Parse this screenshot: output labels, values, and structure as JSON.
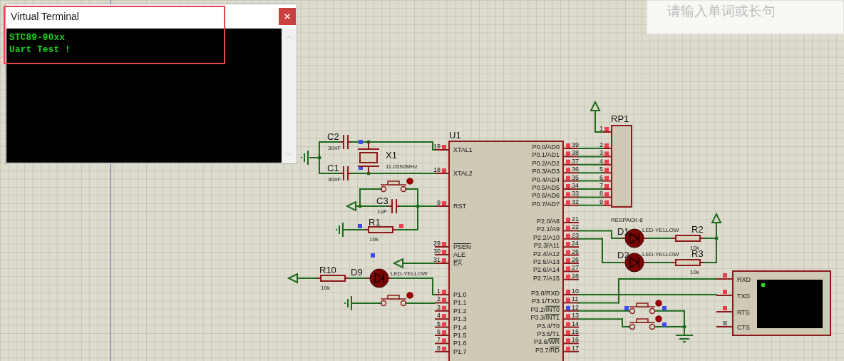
{
  "terminal_window": {
    "title": "Virtual Terminal",
    "lines": [
      "STC89-90xx",
      "Uart Test !"
    ]
  },
  "lookup_box": {
    "placeholder": "请输入单词或长句"
  },
  "schematic": {
    "u1": {
      "ref": "U1",
      "left_pins": [
        {
          "num": "19",
          "name": "XTAL1"
        },
        {
          "num": "18",
          "name": "XTAL2"
        },
        {
          "num": "9",
          "name": "RST"
        },
        {
          "num": "29",
          "inverted": "PSEN"
        },
        {
          "num": "30",
          "name": "ALE"
        },
        {
          "num": "31",
          "inverted": "EA"
        },
        {
          "num": "1",
          "name": "P1.0"
        },
        {
          "num": "2",
          "name": "P1.1"
        },
        {
          "num": "3",
          "name": "P1.2"
        },
        {
          "num": "4",
          "name": "P1.3"
        },
        {
          "num": "5",
          "name": "P1.4"
        },
        {
          "num": "6",
          "name": "P1.5"
        },
        {
          "num": "7",
          "name": "P1.6"
        },
        {
          "num": "8",
          "name": "P1.7"
        }
      ],
      "right_pins": [
        {
          "num": "39",
          "name": "P0.0/AD0"
        },
        {
          "num": "38",
          "name": "P0.1/AD1"
        },
        {
          "num": "37",
          "name": "P0.2/AD2"
        },
        {
          "num": "36",
          "name": "P0.3/AD3"
        },
        {
          "num": "35",
          "name": "P0.4/AD4"
        },
        {
          "num": "34",
          "name": "P0.5/AD5"
        },
        {
          "num": "33",
          "name": "P0.6/AD6"
        },
        {
          "num": "32",
          "name": "P0.7/AD7"
        },
        {
          "num": "21",
          "name": "P2.0/A8"
        },
        {
          "num": "22",
          "name": "P2.1/A9"
        },
        {
          "num": "23",
          "name": "P2.2/A10"
        },
        {
          "num": "24",
          "name": "P2.3/A11"
        },
        {
          "num": "25",
          "name": "P2.4/A12"
        },
        {
          "num": "26",
          "name": "P2.5/A13"
        },
        {
          "num": "27",
          "name": "P2.6/A14"
        },
        {
          "num": "28",
          "name": "P2.7/A15"
        },
        {
          "num": "10",
          "name": "P3.0/RXD"
        },
        {
          "num": "11",
          "name": "P3.1/TXD"
        },
        {
          "num": "12",
          "name": "P3.2/",
          "inverted": "INT0"
        },
        {
          "num": "13",
          "name": "P3.3/",
          "inverted": "INT1"
        },
        {
          "num": "14",
          "name": "P3.4/T0"
        },
        {
          "num": "15",
          "name": "P3.5/T1"
        },
        {
          "num": "16",
          "name": "P3.6/",
          "inverted": "WR"
        },
        {
          "num": "17",
          "name": "P3.7/",
          "inverted": "RD"
        }
      ]
    },
    "rp1": {
      "ref": "RP1",
      "value": "RESPACK-8",
      "pins": [
        "1",
        "2",
        "3",
        "4",
        "5",
        "6",
        "7",
        "8",
        "9"
      ]
    },
    "parts": [
      {
        "kind": "capacitor",
        "ref": "C2",
        "value": "30nF"
      },
      {
        "kind": "capacitor",
        "ref": "C1",
        "value": "30nF"
      },
      {
        "kind": "crystal",
        "ref": "X1",
        "value": "11.0592MHz"
      },
      {
        "kind": "capacitor",
        "ref": "C3",
        "value": "1uF"
      },
      {
        "kind": "resistor",
        "ref": "R1",
        "value": "10k"
      },
      {
        "kind": "resistor",
        "ref": "R10",
        "value": "10k"
      },
      {
        "kind": "led",
        "ref": "D9",
        "value": "LED-YELLOW"
      },
      {
        "kind": "led",
        "ref": "D1",
        "value": "LED-YELLOW"
      },
      {
        "kind": "resistor",
        "ref": "R2",
        "value": "10k"
      },
      {
        "kind": "led",
        "ref": "D2",
        "value": "LED-YELLOW"
      },
      {
        "kind": "resistor",
        "ref": "R3",
        "value": "10k"
      }
    ],
    "terminal_pins": [
      "RXD",
      "TXD",
      "RTS",
      "CTS"
    ]
  }
}
